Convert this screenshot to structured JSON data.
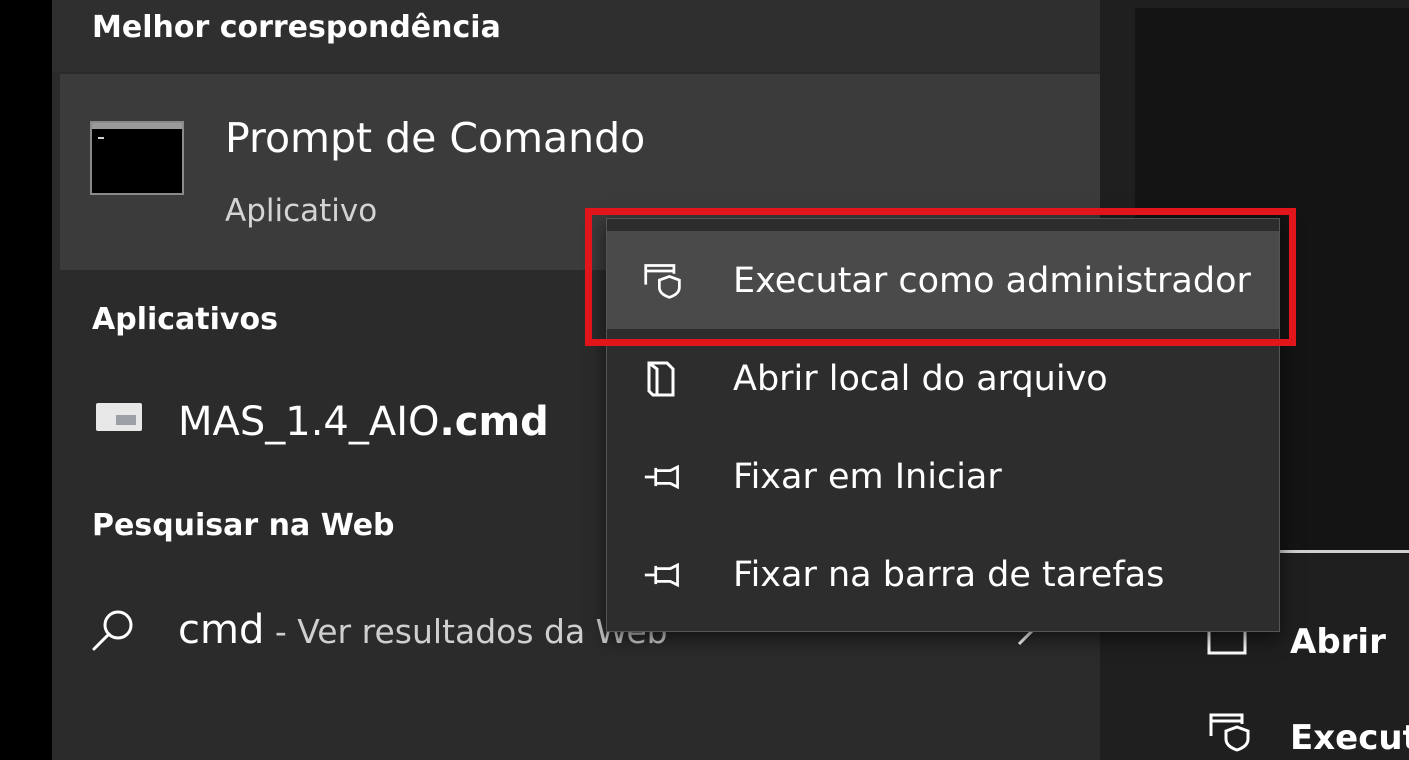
{
  "search_panel": {
    "best_match": {
      "heading": "Melhor correspondência",
      "item_title": "Prompt de Comando",
      "item_type": "Aplicativo",
      "icon": "command-prompt-icon"
    },
    "apps": {
      "heading": "Aplicativos",
      "items": [
        {
          "name_prefix": "MAS_1.4_AIO",
          "name_ext": ".cmd",
          "icon": "batch-file-icon"
        }
      ]
    },
    "web": {
      "heading": "Pesquisar na Web",
      "query": "cmd",
      "suffix": " - Ver resultados da Web",
      "icon": "search-icon",
      "arrow_icon": "chevron-right-icon"
    }
  },
  "context_menu": {
    "items": [
      {
        "label": "Executar como administrador",
        "icon": "shield-window-icon",
        "highlighted": true
      },
      {
        "label": "Abrir local do arquivo",
        "icon": "folder-icon"
      },
      {
        "label": "Fixar em Iniciar",
        "icon": "pin-icon"
      },
      {
        "label": "Fixar na barra de tarefas",
        "icon": "pin-icon"
      }
    ]
  },
  "right_panel": {
    "actions": [
      {
        "label": "Abrir",
        "icon": "open-window-icon"
      },
      {
        "label": "Execut",
        "icon": "shield-window-icon"
      }
    ]
  },
  "colors": {
    "highlight_border": "#e0161b",
    "menu_background": "#2d2d2d",
    "panel_background": "#2b2b2b"
  }
}
